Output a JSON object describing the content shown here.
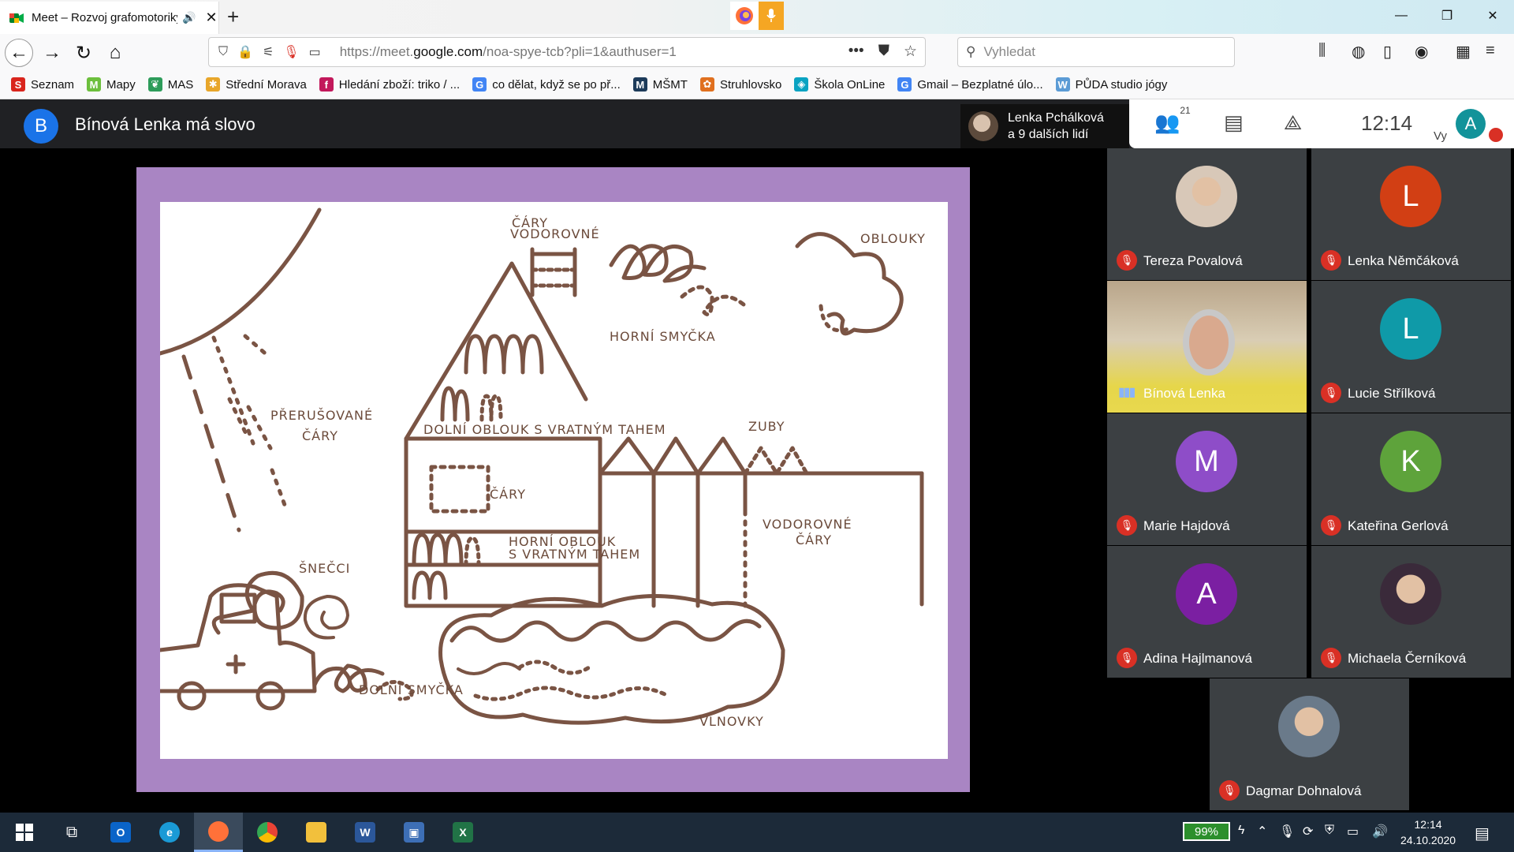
{
  "browser": {
    "tab_title": "Meet – Rozvoj grafomotoriky",
    "url_host_prefix": "https://meet.",
    "url_host": "google.com",
    "url_path": "/noa-spye-tcb?pli=1&authuser=1",
    "search_placeholder": "Vyhledat",
    "bookmarks": [
      {
        "label": "Seznam",
        "color": "#d9251d",
        "glyph": "S"
      },
      {
        "label": "Mapy",
        "color": "#6cbf3c",
        "glyph": "M"
      },
      {
        "label": "MAS",
        "color": "#2d9c5a",
        "glyph": "❦"
      },
      {
        "label": "Střední Morava",
        "color": "#e8a62a",
        "glyph": "✱"
      },
      {
        "label": "Hledání zboží: triko / ...",
        "color": "#c2185b",
        "glyph": "f"
      },
      {
        "label": "co dělat, když se po př...",
        "color": "#4285f4",
        "glyph": "G"
      },
      {
        "label": "MŠMT",
        "color": "#1d3b5a",
        "glyph": "M"
      },
      {
        "label": "Struhlovsko",
        "color": "#e0701f",
        "glyph": "✿"
      },
      {
        "label": "Škola OnLine",
        "color": "#0aa3c2",
        "glyph": "◈"
      },
      {
        "label": "Gmail – Bezplatné úlo...",
        "color": "#4285f4",
        "glyph": "G"
      },
      {
        "label": "PŮDA studio jógy",
        "color": "#5b9bd5",
        "glyph": "W"
      }
    ]
  },
  "meet": {
    "speaker_initial": "B",
    "speaker_title": "Bínová Lenka má slovo",
    "presenter_line1": "Lenka Pchálková",
    "presenter_line2": "a 9 dalších lidí",
    "participant_count": "21",
    "time": "12:14",
    "me_label": "Vy",
    "me_initial": "A"
  },
  "drawing_labels": {
    "cary_vodorovne_top": "ČÁRY",
    "cary_vodorovne_top2": "VODOROVNÉ",
    "oblouky": "OBLOUKY",
    "horni_smycka": "HORNÍ SMYČKA",
    "prerusovane": "PŘERUŠOVANÉ",
    "cary": "ČÁRY",
    "dolni_oblouk": "DOLNÍ OBLOUK S VRATNÝM TAHEM",
    "zuby": "ZUBY",
    "cary_okno": "ČÁRY",
    "vodorovne": "VODOROVNÉ",
    "cary2": "ČÁRY",
    "horni_oblouk": "HORNÍ OBLOUK",
    "s_vratnym": "S VRATNÝM TAHEM",
    "snecci": "ŠNEČCI",
    "dolni_smycka": "DOLNÍ SMYČKA",
    "vlnovky": "VLNOVKY"
  },
  "participants": [
    {
      "name": "Tereza Povalová",
      "initial": "",
      "color": "#d8c8b8",
      "photo": true
    },
    {
      "name": "Lenka Němčáková",
      "initial": "L",
      "color": "#d23f14"
    },
    {
      "name": "Bínová Lenka",
      "initial": "",
      "color": "#5a5a5a",
      "video": true
    },
    {
      "name": "Lucie Střílková",
      "initial": "L",
      "color": "#0f9aa8"
    },
    {
      "name": "Marie Hajdová",
      "initial": "M",
      "color": "#8e4dc8"
    },
    {
      "name": "Kateřina Gerlová",
      "initial": "K",
      "color": "#5ea33b"
    },
    {
      "name": "Adina Hajlmanová",
      "initial": "A",
      "color": "#7b1fa2"
    },
    {
      "name": "Michaela Černíková",
      "initial": "",
      "color": "#3a2a3a",
      "photo": true
    },
    {
      "name": "Dagmar Dohnalová",
      "initial": "",
      "color": "#6a7a8a",
      "photo": true
    }
  ],
  "taskbar": {
    "battery": "99%",
    "clock_time": "12:14",
    "clock_date": "24.10.2020"
  }
}
